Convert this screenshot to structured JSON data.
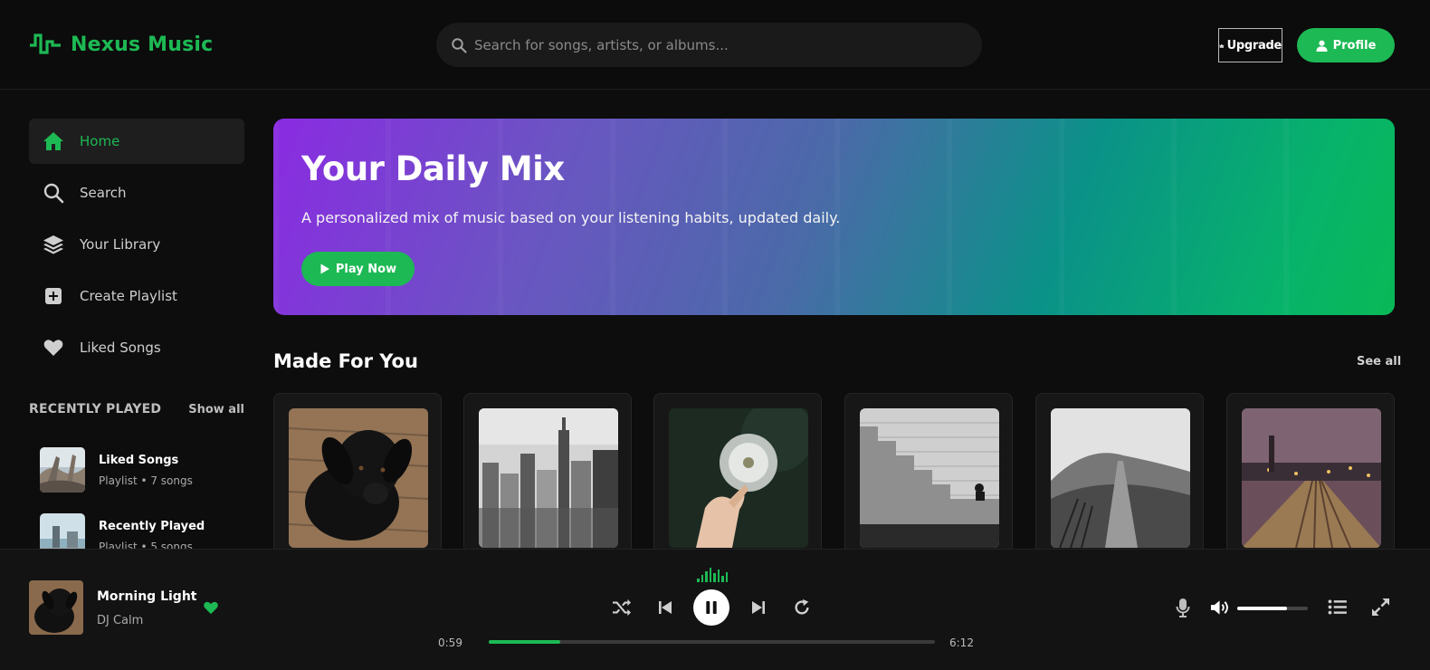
{
  "header": {
    "logo_text": "Nexus Music",
    "search_placeholder": "Search for songs, artists, or albums...",
    "upgrade_label": "Upgrade",
    "profile_label": "Profile"
  },
  "sidebar": {
    "items": [
      {
        "label": "Home",
        "icon": "home-icon",
        "active": true
      },
      {
        "label": "Search",
        "icon": "search-icon"
      },
      {
        "label": "Your Library",
        "icon": "layers-icon"
      },
      {
        "label": "Create Playlist",
        "icon": "plus-square-icon"
      },
      {
        "label": "Liked Songs",
        "icon": "heart-icon"
      }
    ],
    "recently_played": {
      "title": "RECENTLY PLAYED",
      "show_all": "Show all",
      "items": [
        {
          "name": "Liked Songs",
          "meta": "Playlist • 7 songs"
        },
        {
          "name": "Recently Played",
          "meta": "Playlist • 5 songs"
        }
      ]
    }
  },
  "hero": {
    "title": "Your Daily Mix",
    "subtitle": "A personalized mix of music based on your listening habits, updated daily.",
    "play_label": "Play Now"
  },
  "made_for_you": {
    "title": "Made For You",
    "see_all": "See all"
  },
  "player": {
    "track_title": "Morning Light",
    "artist": "DJ Calm",
    "elapsed": "0:59",
    "duration": "6:12",
    "progress": 0.16,
    "volume": 0.71,
    "accent": "#1db954"
  }
}
